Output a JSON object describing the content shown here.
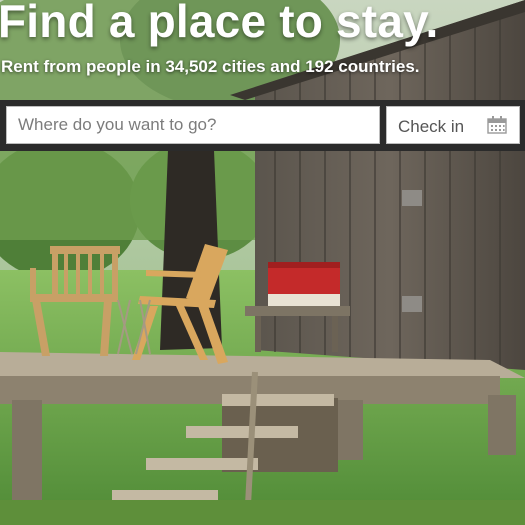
{
  "hero": {
    "headline": "Find a place to stay.",
    "subline": "Rent from people in 34,502 cities and 192 countries."
  },
  "search": {
    "placeholder": "Where do you want to go?",
    "checkin_label": "Check in",
    "checkin_icon": "calendar-icon"
  },
  "colors": {
    "search_bar_bg": "#2b2b2b",
    "headline_text": "#ffffff"
  }
}
